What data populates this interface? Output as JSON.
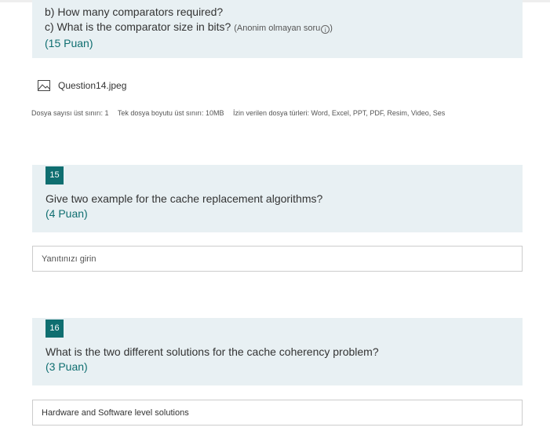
{
  "question14": {
    "line_b": "b) How many comparators required?",
    "line_c": "c) What is the comparator size in bits?",
    "hint_prefix": "(Anonim olmayan soru",
    "hint_suffix": ")",
    "info_glyph": "i",
    "points": "(15 Puan)",
    "attachment_name": "Question14.jpeg",
    "limits": {
      "file_count": "Dosya sayısı üst sınırı: 1",
      "file_size": "Tek dosya boyutu üst sınırı: 10MB",
      "file_types": "İzin verilen dosya türleri: Word, Excel, PPT, PDF, Resim, Video, Ses"
    }
  },
  "question15": {
    "number": "15",
    "title": "Give two example for the cache replacement algorithms?",
    "points": "(4 Puan)",
    "answer_placeholder": "Yanıtınızı girin",
    "answer_value": ""
  },
  "question16": {
    "number": "16",
    "title": "What is the two different solutions for the cache coherency problem?",
    "points": "(3 Puan)",
    "answer_value": "Hardware and Software level solutions"
  },
  "colors": {
    "accent": "#0f6e70",
    "panel_bg": "#e8f0f3",
    "input_border": "#cccccc"
  },
  "icons": {
    "attachment": "image-file-icon",
    "info": "info-circle-icon"
  }
}
